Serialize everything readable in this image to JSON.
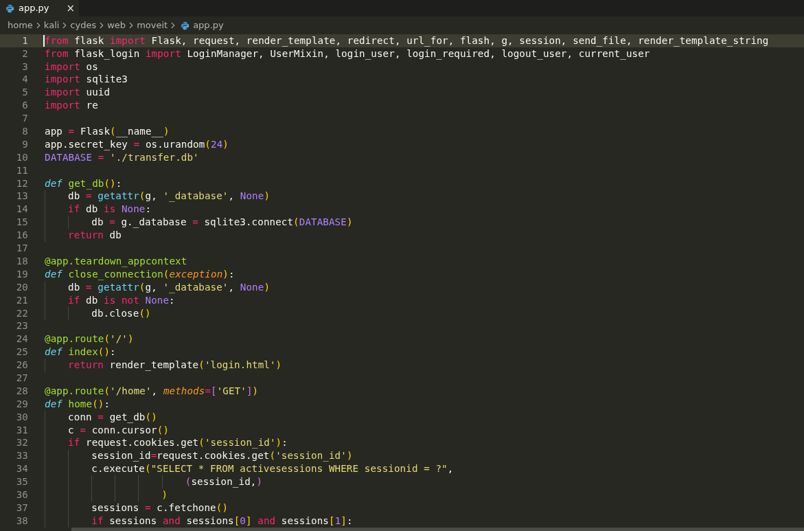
{
  "tabs": [
    {
      "label": "app.py",
      "selected": true,
      "close": "×"
    }
  ],
  "breadcrumb": [
    "home",
    "kali",
    "cydes",
    "web",
    "moveit",
    "app.py"
  ],
  "lines": [
    {
      "number": "1",
      "current": true,
      "tokens": [
        {
          "kind": "kw",
          "text": "from"
        },
        {
          "kind": "txt",
          "text": " flask "
        },
        {
          "kind": "kw",
          "text": "import"
        },
        {
          "kind": "txt",
          "text": " Flask, request, render_template, redirect, url_for, flash, g, session, send_file, render_template_string"
        }
      ]
    },
    {
      "number": "2",
      "current": false,
      "tokens": [
        {
          "kind": "kw",
          "text": "from"
        },
        {
          "kind": "txt",
          "text": " flask_login "
        },
        {
          "kind": "kw",
          "text": "import"
        },
        {
          "kind": "txt",
          "text": " LoginManager, UserMixin, login_user, login_required, logout_user, current_user"
        }
      ]
    },
    {
      "number": "3",
      "current": false,
      "tokens": [
        {
          "kind": "kw",
          "text": "import"
        },
        {
          "kind": "txt",
          "text": " os"
        }
      ]
    },
    {
      "number": "4",
      "current": false,
      "tokens": [
        {
          "kind": "kw",
          "text": "import"
        },
        {
          "kind": "txt",
          "text": " sqlite3"
        }
      ]
    },
    {
      "number": "5",
      "current": false,
      "tokens": [
        {
          "kind": "kw",
          "text": "import"
        },
        {
          "kind": "txt",
          "text": " uuid"
        }
      ]
    },
    {
      "number": "6",
      "current": false,
      "tokens": [
        {
          "kind": "kw",
          "text": "import"
        },
        {
          "kind": "txt",
          "text": " re"
        }
      ]
    },
    {
      "number": "7",
      "current": false
    },
    {
      "number": "8",
      "current": false,
      "tokens": [
        {
          "kind": "txt",
          "text": "app "
        },
        {
          "kind": "op",
          "text": "="
        },
        {
          "kind": "txt",
          "text": " Flask"
        },
        {
          "kind": "b1",
          "text": "("
        },
        {
          "kind": "txt",
          "text": "__name__"
        },
        {
          "kind": "b1",
          "text": ")"
        }
      ]
    },
    {
      "number": "9",
      "current": false,
      "tokens": [
        {
          "kind": "txt",
          "text": "app.secret_key "
        },
        {
          "kind": "op",
          "text": "="
        },
        {
          "kind": "txt",
          "text": " os.urandom"
        },
        {
          "kind": "b1",
          "text": "("
        },
        {
          "kind": "const",
          "text": "24"
        },
        {
          "kind": "b1",
          "text": ")"
        }
      ]
    },
    {
      "number": "10",
      "current": false,
      "tokens": [
        {
          "kind": "const",
          "text": "DATABASE"
        },
        {
          "kind": "op",
          "text": " ="
        },
        {
          "kind": "str",
          "text": " './transfer.db'"
        }
      ]
    },
    {
      "number": "11",
      "current": false
    },
    {
      "number": "12",
      "current": false,
      "tokens": [
        {
          "kind": "def",
          "text": "def"
        },
        {
          "kind": "fn",
          "text": " get_db"
        },
        {
          "kind": "b1",
          "text": "()"
        },
        {
          "kind": "txt",
          "text": ":"
        }
      ]
    },
    {
      "number": "13",
      "current": false,
      "tokens": [
        {
          "kind": "txt",
          "text": "    db "
        },
        {
          "kind": "op",
          "text": "="
        },
        {
          "kind": "call",
          "text": " getattr"
        },
        {
          "kind": "b1",
          "text": "("
        },
        {
          "kind": "txt",
          "text": "g, "
        },
        {
          "kind": "str",
          "text": "'_database'"
        },
        {
          "kind": "txt",
          "text": ", "
        },
        {
          "kind": "const",
          "text": "None"
        },
        {
          "kind": "b1",
          "text": ")"
        }
      ]
    },
    {
      "number": "14",
      "current": false,
      "tokens": [
        {
          "kind": "kw",
          "text": "    if"
        },
        {
          "kind": "txt",
          "text": " db "
        },
        {
          "kind": "kw",
          "text": "is"
        },
        {
          "kind": "const",
          "text": " None"
        },
        {
          "kind": "txt",
          "text": ":"
        }
      ]
    },
    {
      "number": "15",
      "current": false,
      "tokens": [
        {
          "kind": "txt",
          "text": "        db "
        },
        {
          "kind": "op",
          "text": "="
        },
        {
          "kind": "txt",
          "text": " g._database "
        },
        {
          "kind": "op",
          "text": "="
        },
        {
          "kind": "txt",
          "text": " sqlite3.connect"
        },
        {
          "kind": "b1",
          "text": "("
        },
        {
          "kind": "const",
          "text": "DATABASE"
        },
        {
          "kind": "b1",
          "text": ")"
        }
      ]
    },
    {
      "number": "16",
      "current": false,
      "tokens": [
        {
          "kind": "kw",
          "text": "    return"
        },
        {
          "kind": "txt",
          "text": " db"
        }
      ]
    },
    {
      "number": "17",
      "current": false
    },
    {
      "number": "18",
      "current": false,
      "tokens": [
        {
          "kind": "fn",
          "text": "@app.teardown_appcontext"
        }
      ]
    },
    {
      "number": "19",
      "current": false,
      "tokens": [
        {
          "kind": "def",
          "text": "def"
        },
        {
          "kind": "fn",
          "text": " close_connection"
        },
        {
          "kind": "b1",
          "text": "("
        },
        {
          "kind": "param",
          "text": "exception"
        },
        {
          "kind": "b1",
          "text": ")"
        },
        {
          "kind": "txt",
          "text": ":"
        }
      ]
    },
    {
      "number": "20",
      "current": false,
      "tokens": [
        {
          "kind": "txt",
          "text": "    db "
        },
        {
          "kind": "op",
          "text": "="
        },
        {
          "kind": "call",
          "text": " getattr"
        },
        {
          "kind": "b1",
          "text": "("
        },
        {
          "kind": "txt",
          "text": "g, "
        },
        {
          "kind": "str",
          "text": "'_database'"
        },
        {
          "kind": "txt",
          "text": ", "
        },
        {
          "kind": "const",
          "text": "None"
        },
        {
          "kind": "b1",
          "text": ")"
        }
      ]
    },
    {
      "number": "21",
      "current": false,
      "tokens": [
        {
          "kind": "kw",
          "text": "    if"
        },
        {
          "kind": "txt",
          "text": " db "
        },
        {
          "kind": "kw",
          "text": "is"
        },
        {
          "kind": "kw",
          "text": " not"
        },
        {
          "kind": "const",
          "text": " None"
        },
        {
          "kind": "txt",
          "text": ":"
        }
      ]
    },
    {
      "number": "22",
      "current": false,
      "tokens": [
        {
          "kind": "txt",
          "text": "        db.close"
        },
        {
          "kind": "b1",
          "text": "()"
        }
      ]
    },
    {
      "number": "23",
      "current": false
    },
    {
      "number": "24",
      "current": false,
      "tokens": [
        {
          "kind": "fn",
          "text": "@app.route"
        },
        {
          "kind": "b1",
          "text": "("
        },
        {
          "kind": "str",
          "text": "'/'"
        },
        {
          "kind": "b1",
          "text": ")"
        }
      ]
    },
    {
      "number": "25",
      "current": false,
      "tokens": [
        {
          "kind": "def",
          "text": "def"
        },
        {
          "kind": "fn",
          "text": " index"
        },
        {
          "kind": "b1",
          "text": "()"
        },
        {
          "kind": "txt",
          "text": ":"
        }
      ]
    },
    {
      "number": "26",
      "current": false,
      "tokens": [
        {
          "kind": "kw",
          "text": "    return"
        },
        {
          "kind": "txt",
          "text": " render_template"
        },
        {
          "kind": "b1",
          "text": "("
        },
        {
          "kind": "str",
          "text": "'login.html'"
        },
        {
          "kind": "b1",
          "text": ")"
        }
      ]
    },
    {
      "number": "27",
      "current": false
    },
    {
      "number": "28",
      "current": false,
      "tokens": [
        {
          "kind": "fn",
          "text": "@app.route"
        },
        {
          "kind": "b1",
          "text": "("
        },
        {
          "kind": "str",
          "text": "'/home'"
        },
        {
          "kind": "txt",
          "text": ", "
        },
        {
          "kind": "param",
          "text": "methods"
        },
        {
          "kind": "op",
          "text": "="
        },
        {
          "kind": "b2",
          "text": "["
        },
        {
          "kind": "str",
          "text": "'GET'"
        },
        {
          "kind": "b2",
          "text": "]"
        },
        {
          "kind": "b1",
          "text": ")"
        }
      ]
    },
    {
      "number": "29",
      "current": false,
      "tokens": [
        {
          "kind": "def",
          "text": "def"
        },
        {
          "kind": "fn",
          "text": " home"
        },
        {
          "kind": "b1",
          "text": "()"
        },
        {
          "kind": "txt",
          "text": ":"
        }
      ]
    },
    {
      "number": "30",
      "current": false,
      "tokens": [
        {
          "kind": "txt",
          "text": "    conn "
        },
        {
          "kind": "op",
          "text": "="
        },
        {
          "kind": "txt",
          "text": " get_db"
        },
        {
          "kind": "b1",
          "text": "()"
        }
      ]
    },
    {
      "number": "31",
      "current": false,
      "tokens": [
        {
          "kind": "txt",
          "text": "    c "
        },
        {
          "kind": "op",
          "text": "="
        },
        {
          "kind": "txt",
          "text": " conn.cursor"
        },
        {
          "kind": "b1",
          "text": "()"
        }
      ]
    },
    {
      "number": "32",
      "current": false,
      "tokens": [
        {
          "kind": "kw",
          "text": "    if"
        },
        {
          "kind": "txt",
          "text": " request.cookies.get"
        },
        {
          "kind": "b1",
          "text": "("
        },
        {
          "kind": "str",
          "text": "'session_id'"
        },
        {
          "kind": "b1",
          "text": ")"
        },
        {
          "kind": "txt",
          "text": ":"
        }
      ]
    },
    {
      "number": "33",
      "current": false,
      "tokens": [
        {
          "kind": "txt",
          "text": "        session_id"
        },
        {
          "kind": "op",
          "text": "="
        },
        {
          "kind": "txt",
          "text": "request.cookies.get"
        },
        {
          "kind": "b1",
          "text": "("
        },
        {
          "kind": "str",
          "text": "'session_id'"
        },
        {
          "kind": "b1",
          "text": ")"
        }
      ]
    },
    {
      "number": "34",
      "current": false,
      "tokens": [
        {
          "kind": "txt",
          "text": "        c.execute"
        },
        {
          "kind": "b1",
          "text": "("
        },
        {
          "kind": "str",
          "text": "\"SELECT * FROM activesessions WHERE sessionid = ?\""
        },
        {
          "kind": "txt",
          "text": ","
        }
      ]
    },
    {
      "number": "35",
      "current": false,
      "tokens": [
        {
          "kind": "b2",
          "text": "                        ("
        },
        {
          "kind": "txt",
          "text": "session_id,"
        },
        {
          "kind": "b2",
          "text": ")"
        }
      ]
    },
    {
      "number": "36",
      "current": false,
      "tokens": [
        {
          "kind": "b1",
          "text": "                    )"
        }
      ]
    },
    {
      "number": "37",
      "current": false,
      "tokens": [
        {
          "kind": "txt",
          "text": "        sessions "
        },
        {
          "kind": "op",
          "text": "="
        },
        {
          "kind": "txt",
          "text": " c.fetchone"
        },
        {
          "kind": "b1",
          "text": "()"
        }
      ]
    },
    {
      "number": "38",
      "current": false,
      "tokens": [
        {
          "kind": "kw",
          "text": "        if"
        },
        {
          "kind": "txt",
          "text": " sessions "
        },
        {
          "kind": "kw",
          "text": "and"
        },
        {
          "kind": "txt",
          "text": " sessions"
        },
        {
          "kind": "b1",
          "text": "["
        },
        {
          "kind": "const",
          "text": "0"
        },
        {
          "kind": "b1",
          "text": "]"
        },
        {
          "kind": "kw",
          "text": " and"
        },
        {
          "kind": "txt",
          "text": " sessions"
        },
        {
          "kind": "b1",
          "text": "["
        },
        {
          "kind": "const",
          "text": "1"
        },
        {
          "kind": "b1",
          "text": "]"
        },
        {
          "kind": "txt",
          "text": ":"
        }
      ]
    }
  ]
}
